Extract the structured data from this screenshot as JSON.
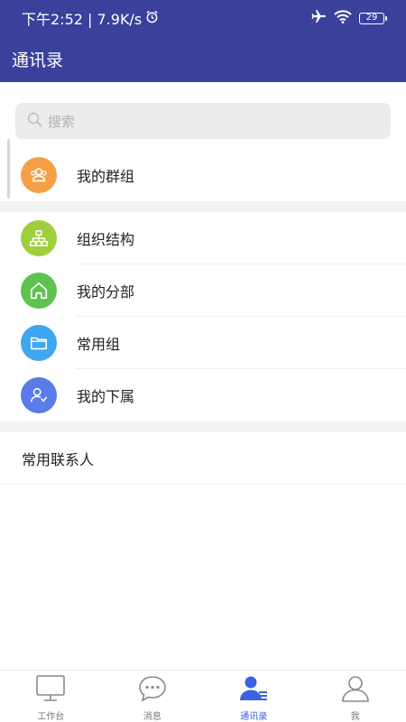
{
  "status_bar": {
    "time_speed": "下午2:52 | 7.9K/s",
    "battery": "29"
  },
  "header": {
    "title": "通讯录"
  },
  "search": {
    "placeholder": "搜索"
  },
  "groups_row": {
    "label": "我的群组",
    "color": "#f5a046",
    "icon": "group-icon"
  },
  "org_items": [
    {
      "label": "组织结构",
      "color": "#9fcf3c",
      "icon": "org-chart-icon"
    },
    {
      "label": "我的分部",
      "color": "#5fc24e",
      "icon": "home-icon"
    },
    {
      "label": "常用组",
      "color": "#3fa6f0",
      "icon": "folder-icon"
    },
    {
      "label": "我的下属",
      "color": "#5a7be8",
      "icon": "subordinate-icon"
    }
  ],
  "section": {
    "title": "常用联系人"
  },
  "tabs": [
    {
      "label": "工作台",
      "icon": "monitor-icon",
      "active": false
    },
    {
      "label": "消息",
      "icon": "message-icon",
      "active": false
    },
    {
      "label": "通讯录",
      "icon": "contacts-icon",
      "active": true
    },
    {
      "label": "我",
      "icon": "profile-icon",
      "active": false
    }
  ],
  "colors": {
    "primary": "#3a419b",
    "tab_active": "#3a63e0"
  }
}
